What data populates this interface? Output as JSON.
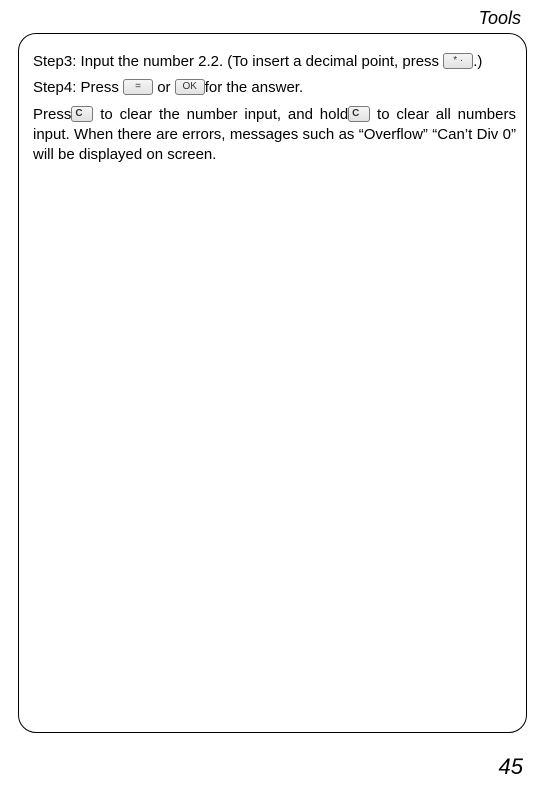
{
  "header": {
    "title": "Tools"
  },
  "body": {
    "step3_a": "Step3: Input the number 2.2. (To insert a decimal point, press",
    "step3_b": ".)",
    "step4_a": "Step4: Press ",
    "step4_or": " or ",
    "step4_b": "for the answer.",
    "press_a": "Press",
    "press_b": " to clear the number input, and hold",
    "press_c": " to clear all numbers input. When there are errors, messages such as “Overflow” “Can’t Div 0” will be displayed on screen."
  },
  "keys": {
    "star": "* ·",
    "equals": "=",
    "ok": "OK",
    "c": "C"
  },
  "footer": {
    "page": "45"
  }
}
